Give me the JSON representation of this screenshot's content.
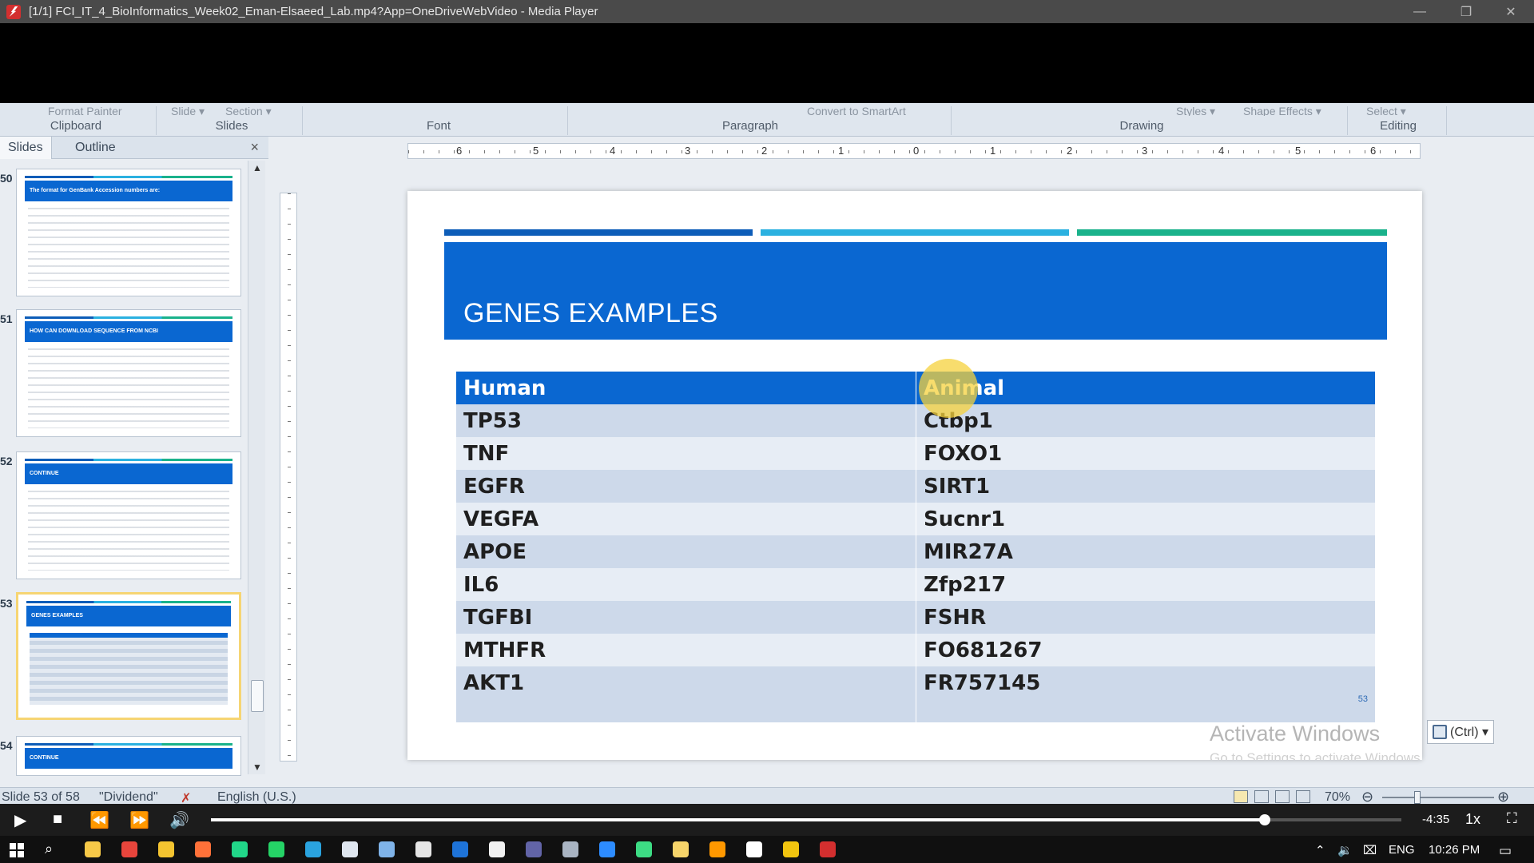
{
  "window": {
    "title": "[1/1] FCI_IT_4_BioInformatics_Week02_Eman-Elsaeed_Lab.mp4?App=OneDriveWebVideo - Media Player",
    "minimize": "—",
    "maximize": "❐",
    "close": "✕"
  },
  "ribbon": {
    "cut_format_painter": "Format Painter",
    "cut_slide": "Slide ▾",
    "cut_section": "Section ▾",
    "cut_smartart": "Convert to SmartArt",
    "cut_styles": "Styles ▾",
    "cut_shape_effects": "Shape Effects ▾",
    "cut_select": "Select ▾",
    "groups": [
      "Clipboard",
      "Slides",
      "Font",
      "Paragraph",
      "Drawing",
      "Editing"
    ]
  },
  "slides_pane": {
    "tabs": [
      "Slides",
      "Outline"
    ],
    "close": "×",
    "thumbnails": [
      {
        "number": "50",
        "header": "The format for GenBank Accession numbers are:"
      },
      {
        "number": "51",
        "header": "HOW CAN DOWNLOAD SEQUENCE FROM NCBI"
      },
      {
        "number": "52",
        "header": "CONTINUE"
      },
      {
        "number": "53",
        "header": "GENES EXAMPLES"
      },
      {
        "number": "54",
        "header": "CONTINUE"
      }
    ]
  },
  "ruler": {
    "labels": [
      "6",
      "5",
      "4",
      "3",
      "2",
      "1",
      "0",
      "1",
      "2",
      "3",
      "4",
      "5",
      "6"
    ]
  },
  "slide": {
    "title": "GENES EXAMPLES",
    "number": "53",
    "accent_colors": [
      "#0d5db8",
      "#2bb1e0",
      "#1ab28b"
    ],
    "header_color": "#0a67d1",
    "table": {
      "headers": [
        "Human",
        "Animal"
      ],
      "rows": [
        [
          "TP53",
          "Ctbp1"
        ],
        [
          "TNF",
          "FOXO1"
        ],
        [
          "EGFR",
          "SIRT1"
        ],
        [
          "VEGFA",
          "Sucnr1"
        ],
        [
          "APOE",
          "MIR27A"
        ],
        [
          "IL6",
          "Zfp217"
        ],
        [
          "TGFBI",
          "FSHR"
        ],
        [
          "MTHFR",
          "FO681267"
        ],
        [
          "AKT1",
          "FR757145"
        ]
      ]
    }
  },
  "watermark": {
    "line1": "Activate Windows",
    "line2": "Go to Settings to activate Windows."
  },
  "paste_options": "(Ctrl) ▾",
  "statusbar": {
    "slide_info": "Slide 53 of 58",
    "theme": "\"Dividend\"",
    "language": "English (U.S.)",
    "zoom": "70%",
    "zoom_minus": "⊖",
    "zoom_plus": "⊕"
  },
  "player": {
    "progress": 0.885,
    "time_remaining": "-4:35",
    "speed": "1x",
    "icons": [
      "play-icon",
      "stop-icon",
      "rewind-icon",
      "fast-forward-icon",
      "volume-icon",
      "fullscreen-icon"
    ]
  },
  "taskbar": {
    "language": "ENG",
    "time": "10:26 PM",
    "apps": [
      {
        "name": "power-automate-icon",
        "color": "#f7c948"
      },
      {
        "name": "chrome-icon",
        "color": "#e8453c"
      },
      {
        "name": "file-explorer-icon",
        "color": "#f4c430"
      },
      {
        "name": "firefox-icon",
        "color": "#ff7139"
      },
      {
        "name": "pycharm-icon",
        "color": "#21d789"
      },
      {
        "name": "whatsapp-icon",
        "color": "#25d366"
      },
      {
        "name": "telegram-icon",
        "color": "#2aa3df"
      },
      {
        "name": "photos-icon",
        "color": "#dfe6ef"
      },
      {
        "name": "notepad-icon",
        "color": "#7fb3e8"
      },
      {
        "name": "calendar-icon",
        "color": "#e5e5e5"
      },
      {
        "name": "outlook-icon",
        "color": "#1e73d8"
      },
      {
        "name": "teams-app-icon",
        "color": "#f0f0f0"
      },
      {
        "name": "teams-icon",
        "color": "#6264a7"
      },
      {
        "name": "store-icon",
        "color": "#a9b4c2"
      },
      {
        "name": "zoom-icon",
        "color": "#2d8cff"
      },
      {
        "name": "android-studio-icon",
        "color": "#3ddc84"
      },
      {
        "name": "sticky-notes-icon",
        "color": "#f6d46a"
      },
      {
        "name": "sublime-icon",
        "color": "#ff9800"
      },
      {
        "name": "vlc-icon",
        "color": "#ffffff"
      },
      {
        "name": "git-icon",
        "color": "#f1c40f"
      },
      {
        "name": "media-player-icon",
        "color": "#d32f2f"
      }
    ]
  }
}
